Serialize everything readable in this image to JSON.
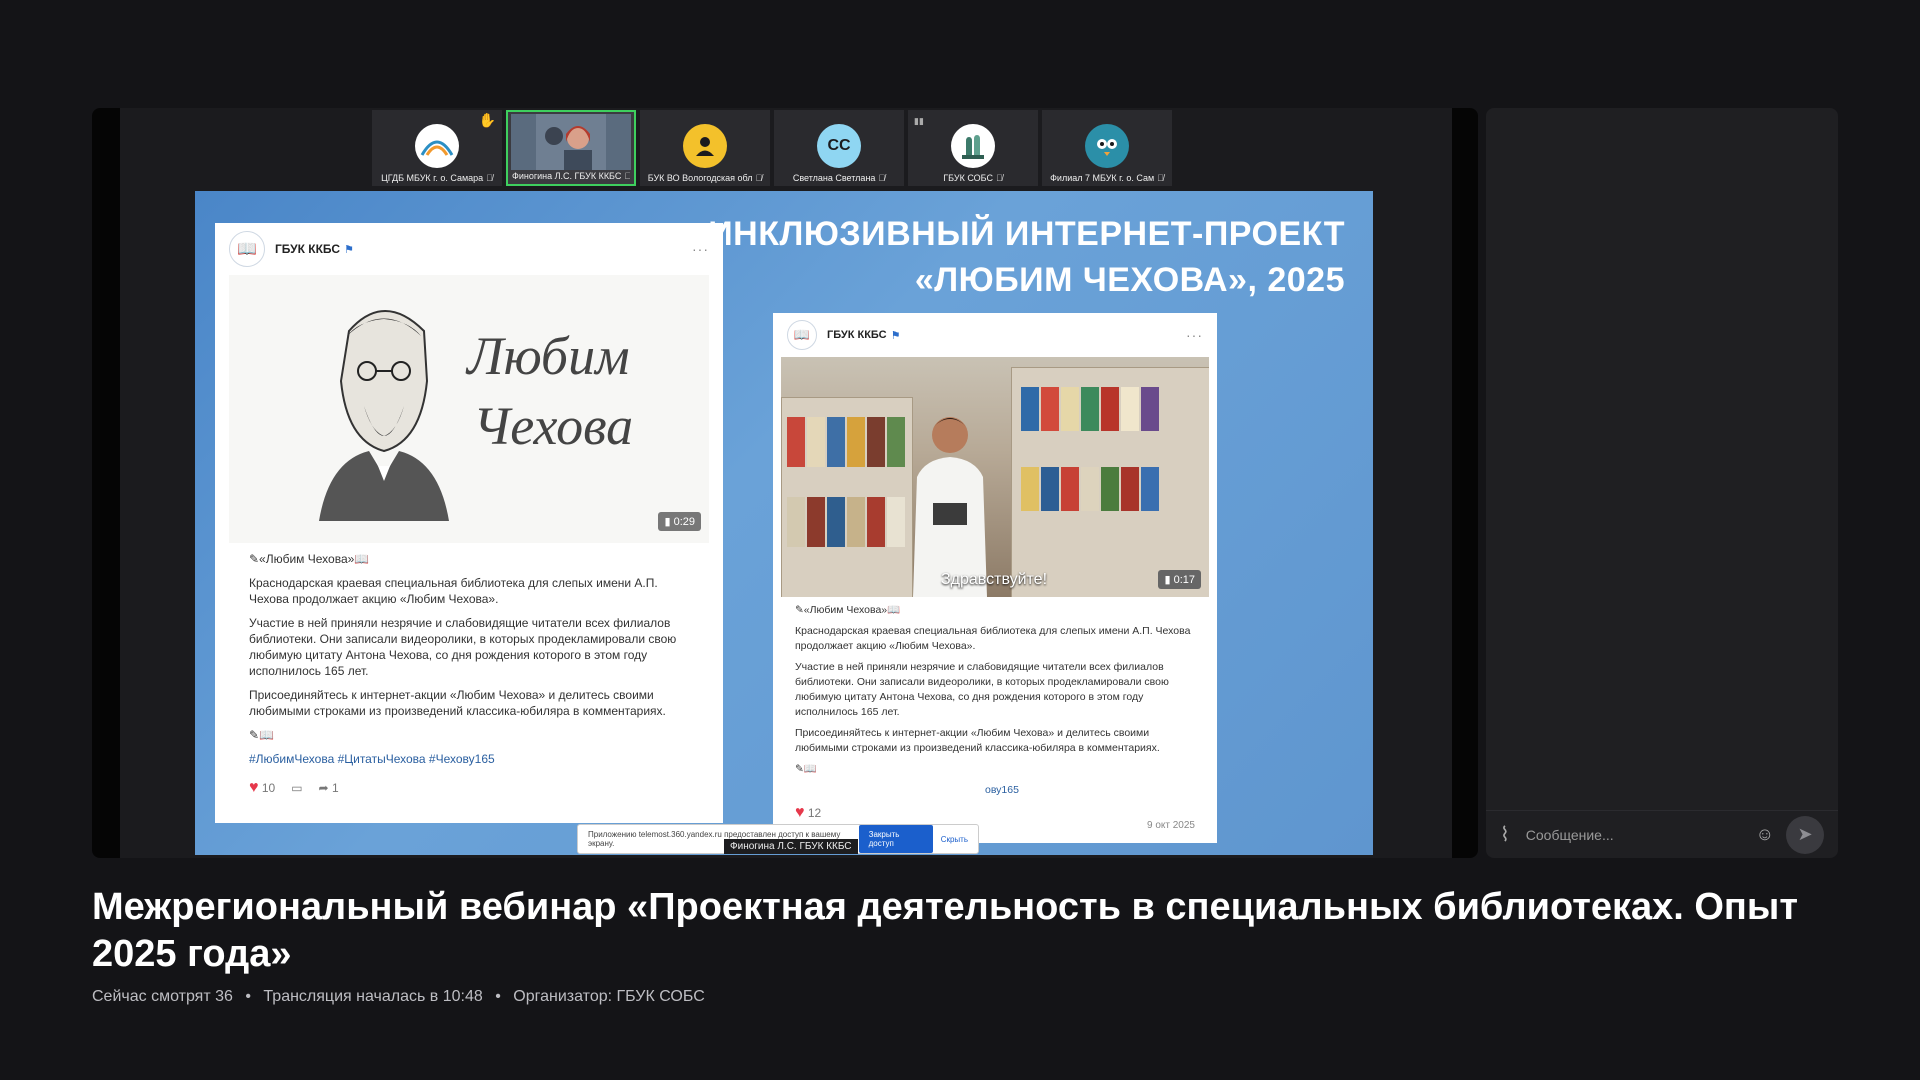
{
  "participants": [
    {
      "name": "ЦГДБ МБУК г. о. Самара",
      "avatar_text": "",
      "avatar_color": "#ffffff",
      "hand_raised": true
    },
    {
      "name": "Финогина Л.С. ГБУК ККБС",
      "avatar_text": "",
      "avatar_color": "#5a6b7e",
      "active": true
    },
    {
      "name": "БУК ВО Вологодская обл",
      "avatar_text": "",
      "avatar_color": "#f3c12b"
    },
    {
      "name": "Светлана Светлана",
      "avatar_text": "СС",
      "avatar_color": "#8fd6f2"
    },
    {
      "name": "ГБУК СОБС",
      "avatar_text": "",
      "avatar_color": "#ffffff"
    },
    {
      "name": "Филиал 7 МБУК г. о. Сам",
      "avatar_text": "",
      "avatar_color": "#2b8fa8"
    }
  ],
  "slide": {
    "title_line1": "ИНКЛЮЗИВНЫЙ ИНТЕРНЕТ-ПРОЕКТ",
    "title_line2": "«ЛЮБИМ ЧЕХОВА», 2025",
    "post1": {
      "author": "ГБУК ККБС",
      "image_text_1": "Любим",
      "image_text_2": "Чехова",
      "duration": "0:29",
      "heading": "✎«Любим Чехова»📖",
      "p1": "Краснодарская краевая специальная библиотека для слепых имени А.П. Чехова продолжает акцию «Любим Чехова».",
      "p2": "Участие в ней приняли незрячие и слабовидящие читатели всех филиалов библиотеки. Они записали видеоролики, в которых продекламировали свою любимую цитату Антона Чехова, со дня рождения которого в этом году исполнилось 165 лет.",
      "p3": "Присоединяйтесь к интернет-акции «Любим Чехова» и делитесь своими любимыми строками из произведений классика-юбиляра в комментариях.",
      "emojis": "✎📖",
      "hashtags": "#ЛюбимЧехова #ЦитатыЧехова #Чехову165",
      "likes": "10",
      "shares": "1"
    },
    "post2": {
      "author": "ГБУК ККБС",
      "video_caption": "Здравствуйте!",
      "duration": "0:17",
      "heading": "✎«Любим Чехова»📖",
      "p1": "Краснодарская краевая специальная библиотека для слепых имени А.П. Чехова продолжает акцию «Любим Чехова».",
      "p2": "Участие в ней приняли незрячие и слабовидящие читатели всех филиалов библиотеки. Они записали видеоролики, в которых продекламировали свою любимую цитату Антона Чехова, со дня рождения которого в этом году исполнилось 165 лет.",
      "p3": "Присоединяйтесь к интернет-акции «Любим Чехова» и делитесь своими любимыми строками из произведений классика-юбиляра в комментариях.",
      "emojis": "✎📖",
      "hashtags_visible": "ову165",
      "likes": "12",
      "date": "9 окт 2025"
    }
  },
  "share_notice": {
    "text": "Приложению telemost.360.yandex.ru предоставлен доступ к вашему экрану.",
    "close_button": "Закрыть доступ",
    "hide_link": "Скрыть"
  },
  "speaker_label": "Финогина Л.С. ГБУК ККБС",
  "chat": {
    "placeholder": "Сообщение..."
  },
  "stream": {
    "title": "Межрегиональный вебинар «Проектная деятельность в специальных библиотеках. Опыт 2025 года»",
    "viewers": "Сейчас смотрят 36",
    "started": "Трансляция началась в 10:48",
    "organizer": "Организатор: ГБУК СОБС",
    "separator": "•"
  }
}
